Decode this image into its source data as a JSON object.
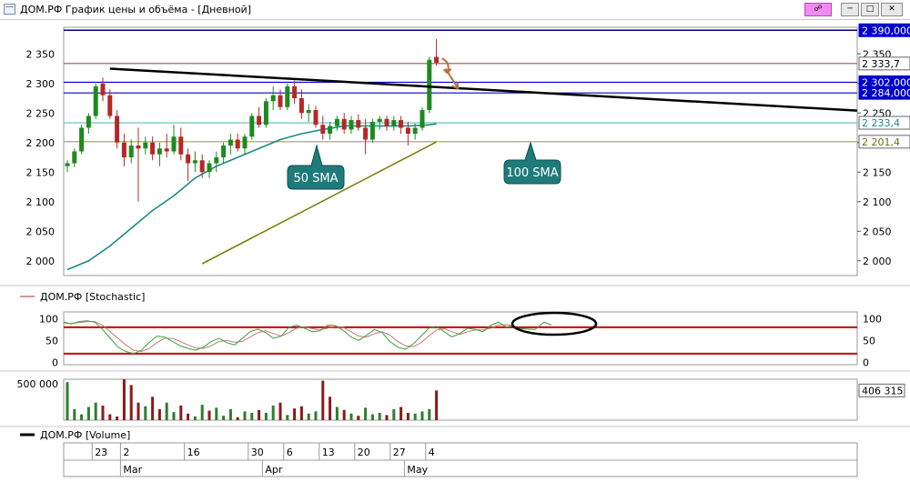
{
  "window": {
    "title": "ДОМ.РФ График цены и объёма - [Дневной]",
    "min_icon": "minimize-icon",
    "max_icon": "maximize-icon",
    "close_icon": "close-icon",
    "link_icon": "link-icon"
  },
  "colors": {
    "up": "#1e8a1e",
    "down": "#b42828",
    "sma50": "#1a8a8a",
    "sma100": "#7f7f10",
    "resistance": "#000000",
    "level_lines": "#0000aa",
    "stoch_levels": "#cc0000",
    "volume_up": "#2f7d2f",
    "volume_down": "#8b1a1a",
    "callout": "#1f7b7b"
  },
  "chart_data": [
    {
      "type": "candlestick",
      "title": "ДОМ.РФ График цены и объёма",
      "ylim": [
        1975,
        2395
      ],
      "y_ticks": [
        "2 350",
        "2 300",
        "2 250",
        "2 200",
        "2 150",
        "2 100",
        "2 050",
        "2 000"
      ],
      "y_tick_values": [
        2350,
        2300,
        2250,
        2200,
        2150,
        2100,
        2050,
        2000
      ],
      "x_ticks": [
        "23",
        "2",
        "16",
        "30",
        "6",
        "13",
        "20",
        "27",
        "4"
      ],
      "x_tick_index": [
        4,
        8,
        17,
        26,
        31,
        36,
        41,
        46,
        51
      ],
      "months": [
        "Mar",
        "Apr",
        "May"
      ],
      "month_index": [
        8,
        28,
        48
      ],
      "candles": [
        {
          "o": 2160,
          "h": 2170,
          "l": 2150,
          "c": 2165
        },
        {
          "o": 2165,
          "h": 2190,
          "l": 2158,
          "c": 2185
        },
        {
          "o": 2185,
          "h": 2230,
          "l": 2180,
          "c": 2225
        },
        {
          "o": 2225,
          "h": 2250,
          "l": 2215,
          "c": 2245
        },
        {
          "o": 2245,
          "h": 2300,
          "l": 2240,
          "c": 2295
        },
        {
          "o": 2300,
          "h": 2310,
          "l": 2270,
          "c": 2280
        },
        {
          "o": 2280,
          "h": 2290,
          "l": 2240,
          "c": 2245
        },
        {
          "o": 2245,
          "h": 2255,
          "l": 2190,
          "c": 2200
        },
        {
          "o": 2200,
          "h": 2215,
          "l": 2160,
          "c": 2175
        },
        {
          "o": 2175,
          "h": 2205,
          "l": 2165,
          "c": 2195
        },
        {
          "o": 2195,
          "h": 2225,
          "l": 2100,
          "c": 2190
        },
        {
          "o": 2190,
          "h": 2210,
          "l": 2180,
          "c": 2200
        },
        {
          "o": 2200,
          "h": 2210,
          "l": 2170,
          "c": 2180
        },
        {
          "o": 2180,
          "h": 2200,
          "l": 2160,
          "c": 2190
        },
        {
          "o": 2190,
          "h": 2215,
          "l": 2175,
          "c": 2185
        },
        {
          "o": 2185,
          "h": 2230,
          "l": 2180,
          "c": 2210
        },
        {
          "o": 2210,
          "h": 2225,
          "l": 2170,
          "c": 2180
        },
        {
          "o": 2180,
          "h": 2190,
          "l": 2135,
          "c": 2165
        },
        {
          "o": 2165,
          "h": 2185,
          "l": 2150,
          "c": 2170
        },
        {
          "o": 2170,
          "h": 2180,
          "l": 2140,
          "c": 2150
        },
        {
          "o": 2150,
          "h": 2170,
          "l": 2140,
          "c": 2165
        },
        {
          "o": 2165,
          "h": 2185,
          "l": 2150,
          "c": 2175
        },
        {
          "o": 2175,
          "h": 2200,
          "l": 2165,
          "c": 2195
        },
        {
          "o": 2195,
          "h": 2215,
          "l": 2180,
          "c": 2205
        },
        {
          "o": 2205,
          "h": 2215,
          "l": 2185,
          "c": 2190
        },
        {
          "o": 2190,
          "h": 2215,
          "l": 2180,
          "c": 2210
        },
        {
          "o": 2210,
          "h": 2250,
          "l": 2205,
          "c": 2245
        },
        {
          "o": 2245,
          "h": 2260,
          "l": 2225,
          "c": 2230
        },
        {
          "o": 2230,
          "h": 2275,
          "l": 2225,
          "c": 2270
        },
        {
          "o": 2270,
          "h": 2295,
          "l": 2255,
          "c": 2280
        },
        {
          "o": 2280,
          "h": 2290,
          "l": 2255,
          "c": 2260
        },
        {
          "o": 2260,
          "h": 2300,
          "l": 2255,
          "c": 2295
        },
        {
          "o": 2295,
          "h": 2305,
          "l": 2265,
          "c": 2275
        },
        {
          "o": 2275,
          "h": 2290,
          "l": 2240,
          "c": 2250
        },
        {
          "o": 2250,
          "h": 2265,
          "l": 2235,
          "c": 2255
        },
        {
          "o": 2255,
          "h": 2262,
          "l": 2225,
          "c": 2230
        },
        {
          "o": 2230,
          "h": 2245,
          "l": 2205,
          "c": 2215
        },
        {
          "o": 2215,
          "h": 2235,
          "l": 2205,
          "c": 2228
        },
        {
          "o": 2228,
          "h": 2245,
          "l": 2220,
          "c": 2240
        },
        {
          "o": 2240,
          "h": 2250,
          "l": 2215,
          "c": 2222
        },
        {
          "o": 2222,
          "h": 2245,
          "l": 2215,
          "c": 2238
        },
        {
          "o": 2238,
          "h": 2248,
          "l": 2220,
          "c": 2225
        },
        {
          "o": 2225,
          "h": 2240,
          "l": 2180,
          "c": 2205
        },
        {
          "o": 2205,
          "h": 2240,
          "l": 2200,
          "c": 2235
        },
        {
          "o": 2235,
          "h": 2245,
          "l": 2222,
          "c": 2240
        },
        {
          "o": 2240,
          "h": 2245,
          "l": 2220,
          "c": 2228
        },
        {
          "o": 2228,
          "h": 2245,
          "l": 2220,
          "c": 2238
        },
        {
          "o": 2238,
          "h": 2245,
          "l": 2215,
          "c": 2225
        },
        {
          "o": 2225,
          "h": 2235,
          "l": 2195,
          "c": 2215
        },
        {
          "o": 2215,
          "h": 2232,
          "l": 2205,
          "c": 2225
        },
        {
          "o": 2225,
          "h": 2260,
          "l": 2220,
          "c": 2255
        },
        {
          "o": 2255,
          "h": 2345,
          "l": 2250,
          "c": 2340
        },
        {
          "o": 2345,
          "h": 2375,
          "l": 2330,
          "c": 2335
        }
      ],
      "sma50_label": "50 SMA",
      "sma50": [
        [
          0,
          1985
        ],
        [
          3,
          2000
        ],
        [
          6,
          2025
        ],
        [
          9,
          2055
        ],
        [
          12,
          2085
        ],
        [
          15,
          2110
        ],
        [
          18,
          2140
        ],
        [
          21,
          2160
        ],
        [
          24,
          2175
        ],
        [
          27,
          2190
        ],
        [
          30,
          2205
        ],
        [
          33,
          2215
        ],
        [
          36,
          2222
        ],
        [
          39,
          2228
        ],
        [
          42,
          2228
        ],
        [
          45,
          2228
        ],
        [
          48,
          2228
        ],
        [
          51,
          2230
        ],
        [
          52,
          2232
        ]
      ],
      "sma100_label": "100 SMA",
      "sma100": [
        [
          19,
          1995
        ],
        [
          52,
          2201
        ]
      ],
      "resistance_line": [
        [
          6,
          2325
        ],
        [
          58,
          2254
        ]
      ],
      "level_lines": [
        {
          "value": 2390.0,
          "label": "2 390,000",
          "style": "navy",
          "boxed": true,
          "dark": true
        },
        {
          "value": 2333.7,
          "label": "2 333,7",
          "style": "brown",
          "boxed": true,
          "dark": false
        },
        {
          "value": 2302.0,
          "label": "2 302,000",
          "style": "blue",
          "boxed": true,
          "dark": true
        },
        {
          "value": 2284.0,
          "label": "2 284,000",
          "style": "blue",
          "boxed": true,
          "dark": true
        },
        {
          "value": 2233.4,
          "label": "2 233,4",
          "style": "teal",
          "boxed": true,
          "dark": false
        },
        {
          "value": 2201.4,
          "label": "2 201,4",
          "style": "olive",
          "boxed": true,
          "dark": false
        }
      ]
    },
    {
      "type": "line",
      "title": "ДОМ.РФ [Stochastic]",
      "ylim": [
        -5,
        115
      ],
      "y_ticks": [
        "100",
        "50",
        "0"
      ],
      "y_tick_values": [
        100,
        50,
        0
      ],
      "levels": [
        80,
        20
      ],
      "k": [
        92,
        88,
        93,
        95,
        92,
        75,
        55,
        35,
        25,
        20,
        28,
        45,
        60,
        58,
        48,
        38,
        32,
        28,
        35,
        48,
        55,
        45,
        40,
        55,
        70,
        76,
        68,
        55,
        60,
        80,
        85,
        78,
        70,
        72,
        85,
        84,
        73,
        58,
        50,
        62,
        75,
        68,
        48,
        35,
        30,
        42,
        60,
        78,
        82,
        70,
        58,
        66,
        78,
        75,
        70,
        85,
        92,
        80,
        85
      ],
      "d": [
        90,
        89,
        91,
        93,
        93,
        85,
        70,
        55,
        40,
        28,
        25,
        32,
        45,
        55,
        55,
        48,
        40,
        33,
        32,
        38,
        48,
        50,
        46,
        48,
        58,
        68,
        72,
        66,
        60,
        68,
        78,
        81,
        77,
        74,
        78,
        82,
        80,
        70,
        60,
        58,
        65,
        70,
        62,
        48,
        38,
        36,
        45,
        60,
        74,
        77,
        70,
        64,
        70,
        74,
        74,
        78,
        85,
        86,
        84
      ]
    },
    {
      "type": "bar",
      "title": "ДОМ.РФ [Volume]",
      "ylim": [
        0,
        560000
      ],
      "y_ticks": [
        "500 000"
      ],
      "y_tick_values": [
        500000
      ],
      "last_value_label": "406 315",
      "values": [
        520000,
        150000,
        80000,
        180000,
        240000,
        200000,
        80000,
        50000,
        560000,
        480000,
        240000,
        190000,
        320000,
        150000,
        240000,
        110000,
        200000,
        90000,
        50000,
        210000,
        130000,
        170000,
        60000,
        150000,
        40000,
        120000,
        100000,
        140000,
        100000,
        200000,
        240000,
        70000,
        160000,
        190000,
        90000,
        120000,
        540000,
        320000,
        180000,
        140000,
        90000,
        60000,
        170000,
        80000,
        100000,
        70000,
        150000,
        180000,
        100000,
        90000,
        120000,
        150000,
        406315
      ],
      "up": [
        true,
        true,
        true,
        true,
        true,
        false,
        false,
        false,
        false,
        false,
        false,
        true,
        false,
        false,
        true,
        true,
        false,
        false,
        true,
        true,
        false,
        true,
        true,
        true,
        false,
        true,
        true,
        false,
        true,
        true,
        false,
        true,
        false,
        false,
        true,
        true,
        false,
        false,
        true,
        false,
        true,
        false,
        true,
        true,
        true,
        false,
        true,
        false,
        false,
        true,
        true,
        true,
        false
      ]
    }
  ],
  "callouts": {
    "sma50": "50 SMA",
    "sma100": "100 SMA"
  }
}
